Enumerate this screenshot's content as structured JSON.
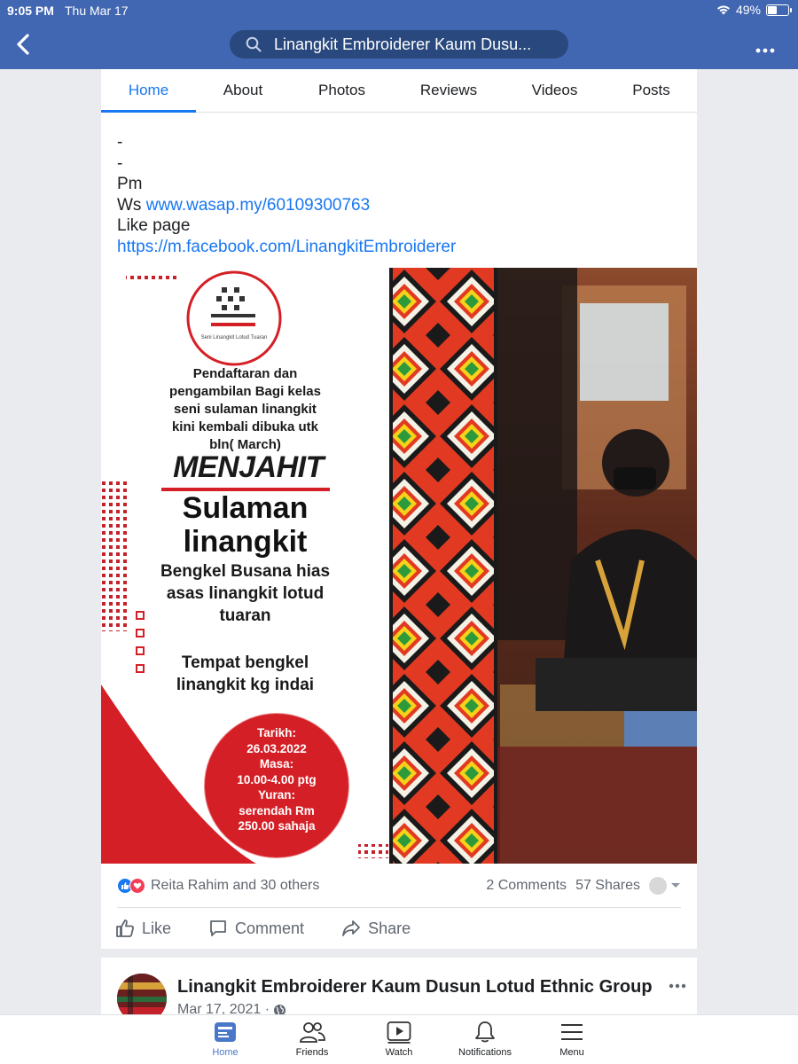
{
  "status_bar": {
    "time": "9:05 PM",
    "date": "Thu Mar 17",
    "battery": "49%",
    "battery_level": 0.49
  },
  "header": {
    "search_text": "Linangkit Embroiderer Kaum Dusu..."
  },
  "tabs": [
    {
      "label": "Home",
      "active": true
    },
    {
      "label": "About"
    },
    {
      "label": "Photos"
    },
    {
      "label": "Reviews"
    },
    {
      "label": "Videos"
    },
    {
      "label": "Posts"
    }
  ],
  "post": {
    "lines": [
      "-",
      "-",
      "Pm"
    ],
    "ws_prefix": "Ws ",
    "ws_link": "www.wasap.my/60109300763",
    "like_page": "Like page",
    "fb_link": "https://m.facebook.com/LinangkitEmbroiderer",
    "image": {
      "logo_caption": "Seni Linangkit Lotud Tuaran",
      "intro": [
        "Pendaftaran dan",
        "pengambilan Bagi kelas",
        "seni sulaman linangkit",
        "kini kembali dibuka utk",
        "bln( March)"
      ],
      "headline1": "MENJAHIT",
      "headline2": [
        "Sulaman",
        "linangkit"
      ],
      "subtitle": [
        "Bengkel Busana hias",
        "asas linangkit lotud",
        "tuaran"
      ],
      "venue": [
        "Tempat bengkel",
        "linangkit kg indai"
      ],
      "badge": [
        "Tarikh:",
        "26.03.2022",
        "Masa:",
        "10.00-4.00 ptg",
        "Yuran:",
        "serendah Rm",
        "250.00 sahaja"
      ]
    },
    "reactions_text": "Reita Rahim and 30 others",
    "comments": "2 Comments",
    "shares": "57 Shares",
    "actions": {
      "like": "Like",
      "comment": "Comment",
      "share": "Share"
    }
  },
  "next_post": {
    "page_name": "Linangkit Embroiderer Kaum Dusun Lotud Ethnic Group",
    "date": "Mar 17, 2021 ·"
  },
  "bottom_nav": [
    {
      "label": "Home",
      "icon": "home-feed-icon",
      "active": true
    },
    {
      "label": "Friends",
      "icon": "friends-icon"
    },
    {
      "label": "Watch",
      "icon": "watch-icon"
    },
    {
      "label": "Notifications",
      "icon": "bell-icon"
    },
    {
      "label": "Menu",
      "icon": "menu-icon"
    }
  ],
  "colors": {
    "brand_blue": "#4267b2",
    "link_blue": "#1877f2",
    "poster_red": "#d51f26"
  }
}
